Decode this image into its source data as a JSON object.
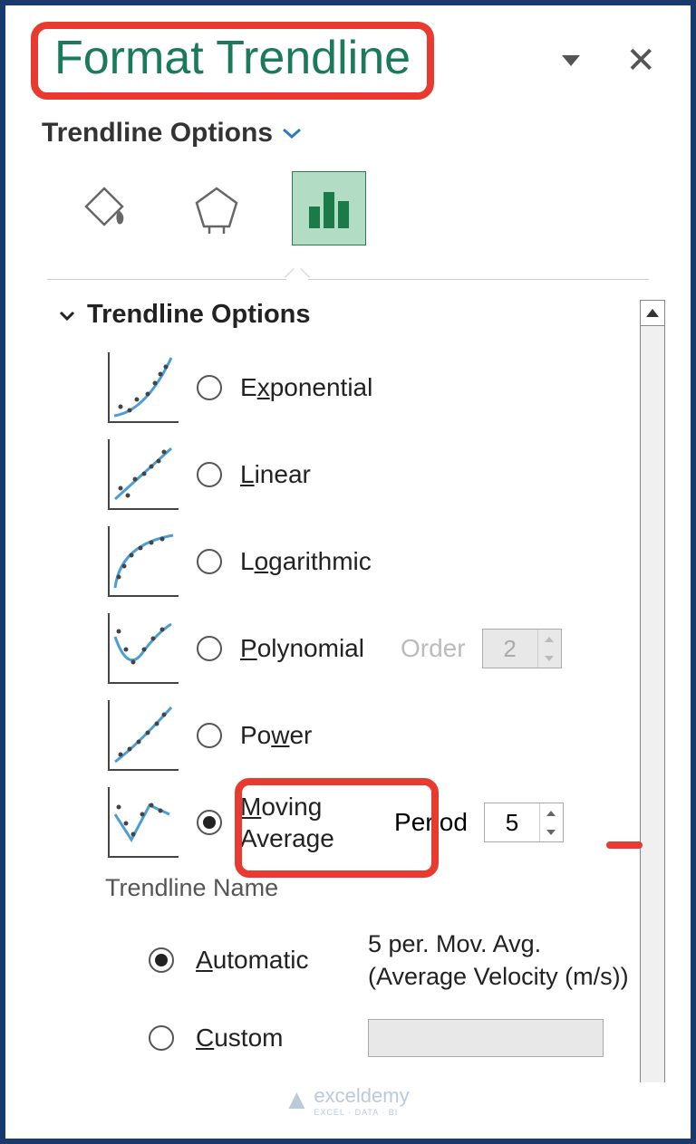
{
  "header": {
    "title": "Format Trendline",
    "subtitle": "Trendline Options"
  },
  "tabs": {
    "fill_icon": "paint-bucket-icon",
    "effects_icon": "pentagon-icon",
    "chart_icon": "bar-chart-icon",
    "active": "chart"
  },
  "section": {
    "title": "Trendline Options",
    "options": [
      {
        "label_pre": "E",
        "label_ul": "x",
        "label_post": "ponential",
        "checked": false
      },
      {
        "label_pre": "",
        "label_ul": "L",
        "label_post": "inear",
        "checked": false
      },
      {
        "label_pre": "L",
        "label_ul": "o",
        "label_post": "garithmic",
        "checked": false
      },
      {
        "label_pre": "",
        "label_ul": "P",
        "label_post": "olynomial",
        "checked": false,
        "extra_label_pre": "O",
        "extra_label_ul": "r",
        "extra_label_post": "der",
        "extra_value": "2",
        "extra_disabled": true
      },
      {
        "label_pre": "Po",
        "label_ul": "w",
        "label_post": "er",
        "checked": false
      },
      {
        "label_pre": "Moving\nAverage",
        "label_ul": "",
        "label_post": "",
        "checked": true,
        "extra_label_pre": "P",
        "extra_label_ul": "e",
        "extra_label_post": "riod",
        "extra_value": "5",
        "extra_disabled": false
      }
    ],
    "trendline_name_label": "Trendline Name",
    "name_options": {
      "automatic": {
        "label_ul": "A",
        "label_post": "utomatic",
        "checked": true,
        "value": "5 per. Mov. Avg. (Average Velocity (m/s))"
      },
      "custom": {
        "label_ul": "C",
        "label_post": "ustom",
        "checked": false,
        "value": ""
      }
    }
  },
  "watermark": {
    "text": "exceldemy",
    "sub": "EXCEL · DATA · BI"
  }
}
